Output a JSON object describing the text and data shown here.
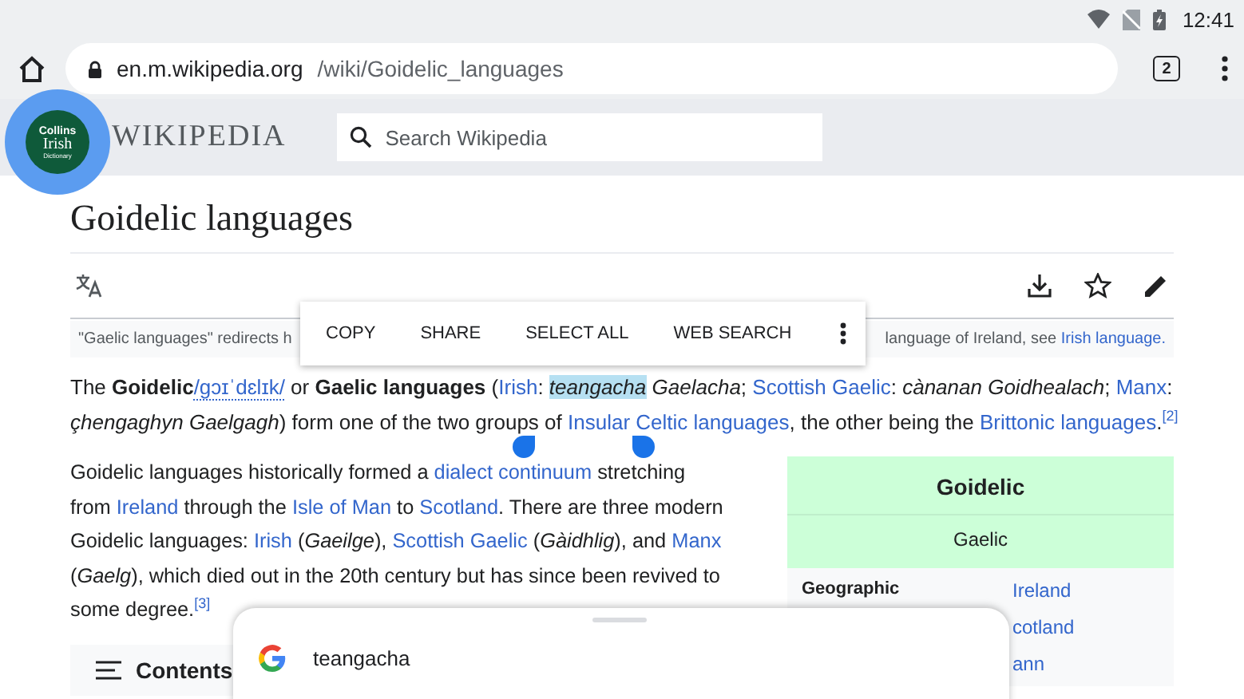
{
  "status_bar": {
    "time": "12:41"
  },
  "browser": {
    "url_host": "en.m.wikipedia.org",
    "url_path": "/wiki/Goidelic_languages",
    "tab_count": "2"
  },
  "bubble": {
    "lines": [
      "Collins",
      "Irish",
      "Dictionary"
    ]
  },
  "wiki_header": {
    "logo": "WIKIPEDIA",
    "search_placeholder": "Search Wikipedia"
  },
  "article": {
    "title": "Goidelic languages",
    "hatnote": {
      "left": "\"Gaelic languages\" redirects h",
      "right": "language of Ireland, see ",
      "link": "Irish language."
    },
    "text_menu": [
      "COPY",
      "SHARE",
      "SELECT ALL",
      "WEB SEARCH"
    ],
    "lead": [
      {
        "kind": "text",
        "text": "The "
      },
      {
        "kind": "bold",
        "text": "Goidelic"
      },
      {
        "kind": "space"
      },
      {
        "kind": "ipa",
        "text": "/ɡɔɪˈdɛlɪk/"
      },
      {
        "kind": "text",
        "text": " or "
      },
      {
        "kind": "bold",
        "text": "Gaelic languages"
      },
      {
        "kind": "text",
        "text": " ("
      },
      {
        "kind": "link",
        "text": "Irish"
      },
      {
        "kind": "text",
        "text": ": "
      },
      {
        "kind": "selected",
        "text": "teangacha"
      },
      {
        "kind": "italic",
        "text": " Gaelacha"
      },
      {
        "kind": "text",
        "text": "; "
      },
      {
        "kind": "link",
        "text": "Scottish Gaelic"
      },
      {
        "kind": "text",
        "text": ": "
      },
      {
        "kind": "italic",
        "text": "cànanan Goidhealach"
      },
      {
        "kind": "text",
        "text": "; "
      },
      {
        "kind": "link",
        "text": "Manx"
      },
      {
        "kind": "text",
        "text": ":"
      },
      {
        "kind": "br"
      },
      {
        "kind": "italic",
        "text": "çhengaghyn Gaelgagh"
      },
      {
        "kind": "text",
        "text": ") form one of the two groups of "
      },
      {
        "kind": "link",
        "text": "Insular Celtic languages"
      },
      {
        "kind": "text",
        "text": ", the other being the "
      },
      {
        "kind": "link",
        "text": "Brittonic languages"
      },
      {
        "kind": "text",
        "text": "."
      },
      {
        "kind": "sup",
        "text": "[2]"
      }
    ],
    "body": [
      {
        "kind": "text",
        "text": "Goidelic languages historically formed a "
      },
      {
        "kind": "link",
        "text": "dialect continuum"
      },
      {
        "kind": "text",
        "text": " stretching"
      },
      {
        "kind": "br"
      },
      {
        "kind": "text",
        "text": "from "
      },
      {
        "kind": "link",
        "text": "Ireland"
      },
      {
        "kind": "text",
        "text": " through the "
      },
      {
        "kind": "link",
        "text": "Isle of Man"
      },
      {
        "kind": "text",
        "text": " to "
      },
      {
        "kind": "link",
        "text": "Scotland"
      },
      {
        "kind": "text",
        "text": ". There are three modern"
      },
      {
        "kind": "br"
      },
      {
        "kind": "text",
        "text": "Goidelic languages: "
      },
      {
        "kind": "link",
        "text": "Irish"
      },
      {
        "kind": "text",
        "text": " ("
      },
      {
        "kind": "italic",
        "text": "Gaeilge"
      },
      {
        "kind": "text",
        "text": "), "
      },
      {
        "kind": "link",
        "text": "Scottish Gaelic"
      },
      {
        "kind": "text",
        "text": " ("
      },
      {
        "kind": "italic",
        "text": "Gàidhlig"
      },
      {
        "kind": "text",
        "text": "), and "
      },
      {
        "kind": "link",
        "text": "Manx"
      },
      {
        "kind": "br"
      },
      {
        "kind": "text",
        "text": "("
      },
      {
        "kind": "italic",
        "text": "Gaelg"
      },
      {
        "kind": "text",
        "text": "), which died out in the 20th century but has since been revived to"
      },
      {
        "kind": "br"
      },
      {
        "kind": "text",
        "text": "some degree."
      },
      {
        "kind": "sup",
        "text": "[3]"
      }
    ],
    "contents_label": "Contents",
    "infobox": {
      "title": "Goidelic",
      "subtitle": "Gaelic",
      "rows": [
        {
          "label": "Geographic",
          "values": [
            "Ireland",
            "cotland",
            "ann"
          ]
        }
      ]
    }
  },
  "bottom_sheet": {
    "query": "teangacha"
  }
}
